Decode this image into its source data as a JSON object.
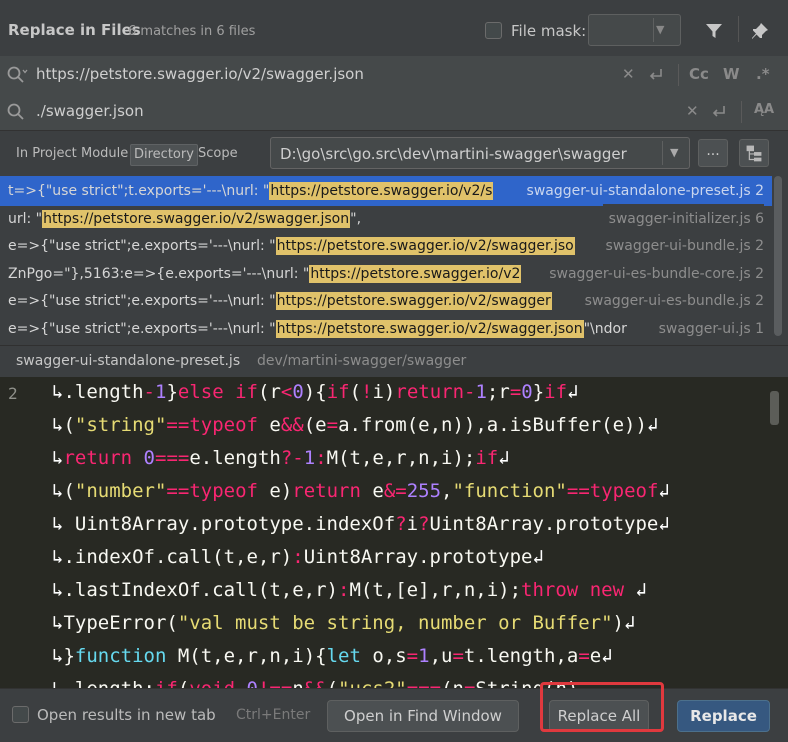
{
  "header": {
    "title": "Replace in Files",
    "match_summary": "6 matches in 6 files",
    "file_mask_label": "File mask:",
    "file_mask_checked": false,
    "file_mask_value": ""
  },
  "search": {
    "find_value": "https://petstore.swagger.io/v2/swagger.json",
    "replace_value": "./swagger.json",
    "find_options": [
      "Cc",
      "W",
      ".*"
    ],
    "icons": [
      "search-icon",
      "clear-icon",
      "newline-icon",
      "replace-icon",
      "preserve-case-icon"
    ]
  },
  "scope": {
    "tabs": [
      "In Project",
      "Module",
      "Directory",
      "Scope"
    ],
    "selected_tab": "Directory",
    "directory": "D:\\go\\src\\go.src\\dev\\martini-swagger\\swagger",
    "browse_label": "..."
  },
  "results": [
    {
      "prefix": "t=>{\"use strict\";t.exports='---\\nurl: \"",
      "match": "https://petstore.swagger.io/v2/s",
      "suffix": "",
      "file": "swagger-ui-standalone-preset.js 2",
      "selected": true
    },
    {
      "prefix": "url: \"",
      "match": "https://petstore.swagger.io/v2/swagger.json",
      "suffix": "\",",
      "file": "swagger-initializer.js 6",
      "selected": false
    },
    {
      "prefix": "e=>{\"use strict\";e.exports='---\\nurl: \"",
      "match": "https://petstore.swagger.io/v2/swagger.jso",
      "suffix": "",
      "file": "swagger-ui-bundle.js 2",
      "selected": false
    },
    {
      "prefix": "ZnPgo=\"},5163:e=>{e.exports='---\\nurl: \"",
      "match": "https://petstore.swagger.io/v2",
      "suffix": "",
      "file": "swagger-ui-es-bundle-core.js 2",
      "selected": false
    },
    {
      "prefix": "e=>{\"use strict\";e.exports='---\\nurl: \"",
      "match": "https://petstore.swagger.io/v2/swagger",
      "suffix": "",
      "file": "swagger-ui-es-bundle.js 2",
      "selected": false
    },
    {
      "prefix": "e=>{\"use strict\";e.exports='---\\nurl: \"",
      "match": "https://petstore.swagger.io/v2/swagger.json",
      "suffix": "\"\\ndor",
      "file": "swagger-ui.js 1",
      "selected": false
    }
  ],
  "preview": {
    "file_name": "swagger-ui-standalone-preset.js",
    "file_dir": "dev/martini-swagger/swagger",
    "line_number": "2"
  },
  "footer": {
    "open_new_tab_label": "Open results in new tab",
    "open_new_tab_checked": false,
    "shortcut": "Ctrl+Enter",
    "open_find_window_label": "Open in Find Window",
    "replace_all_label": "Replace All",
    "replace_label": "Replace"
  },
  "colors": {
    "selection": "#2f65ca",
    "match_highlight": "#e0c26a",
    "primary_button": "#365880",
    "annotation_ring": "#e0393e"
  }
}
